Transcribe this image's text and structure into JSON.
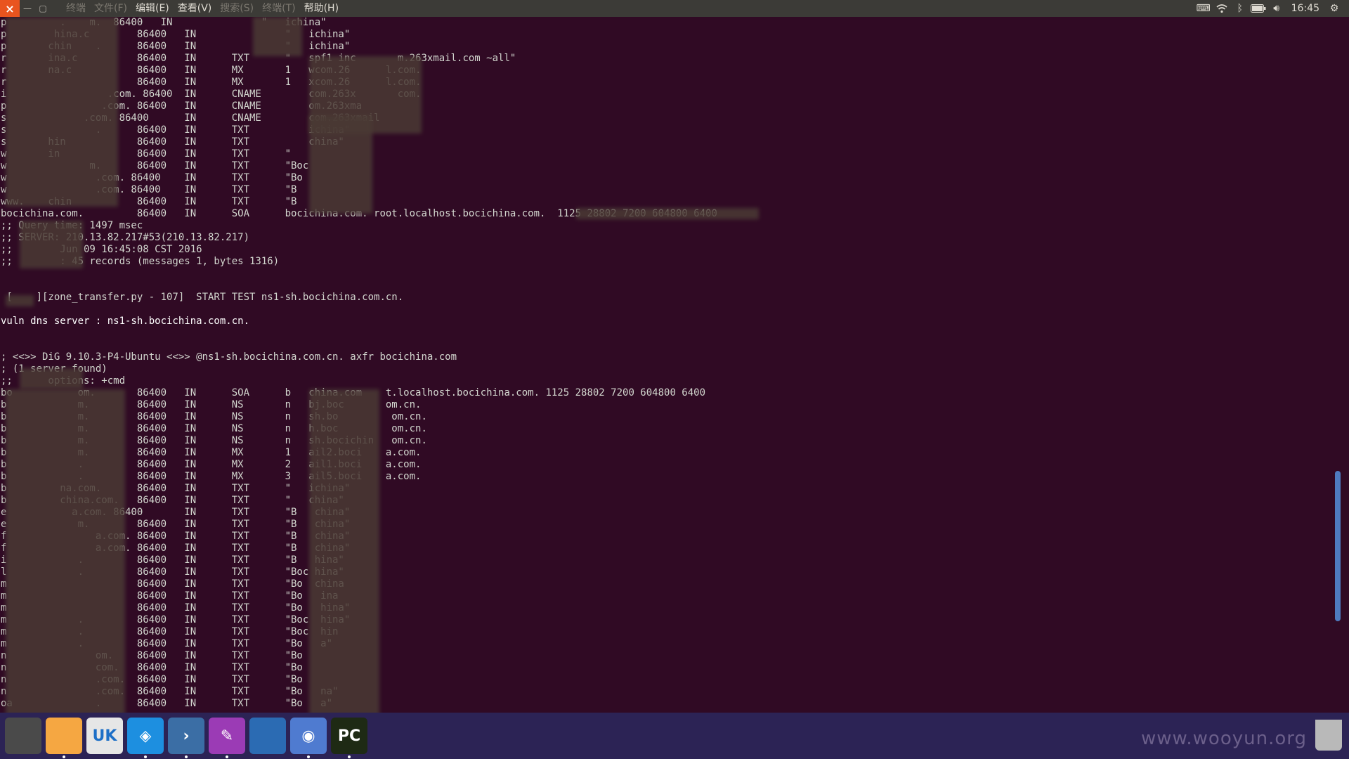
{
  "window": {
    "menus": [
      {
        "label": "终端",
        "dim": true
      },
      {
        "label": "文件(F)",
        "dim": true
      },
      {
        "label": "编辑(E)",
        "dim": false
      },
      {
        "label": "查看(V)",
        "dim": false
      },
      {
        "label": "搜索(S)",
        "dim": true
      },
      {
        "label": "终端(T)",
        "dim": true
      },
      {
        "label": "帮助(H)",
        "dim": false
      }
    ]
  },
  "tray": {
    "icons": [
      "keyboard-icon",
      "wifi-icon",
      "bluetooth-icon",
      "battery-icon",
      "volume-icon"
    ],
    "clock": "16:45",
    "settings_icon": "gear-icon"
  },
  "terminal": {
    "lines": [
      {
        "text": "p         .    m.  86400   IN               \"   ichina\"",
        "style": "normal"
      },
      {
        "text": "p        hina.c        86400   IN               \"   ichina\"",
        "style": "normal"
      },
      {
        "text": "p       chin    .      86400   IN               \"   ichina\"",
        "style": "normal"
      },
      {
        "text": "r       ina.c          86400   IN      TXT      \"   spf1 inc       m.263xmail.com ~all\"",
        "style": "normal"
      },
      {
        "text": "r       na.c           86400   IN      MX       1   wcom.26      l.com.",
        "style": "normal"
      },
      {
        "text": "r                      86400   IN      MX       1   xcom.26      l.com.",
        "style": "normal"
      },
      {
        "text": "i                 .com. 86400  IN      CNAME        com.263x       com.",
        "style": "normal"
      },
      {
        "text": "p                .com. 86400   IN      CNAME        om.263xma",
        "style": "normal"
      },
      {
        "text": "s             .com. 86400      IN      CNAME        com.263xmail",
        "style": "normal"
      },
      {
        "text": "s               .      86400   IN      TXT          ichina\"",
        "style": "normal"
      },
      {
        "text": "s       hin            86400   IN      TXT          china\"",
        "style": "normal"
      },
      {
        "text": "w       in             86400   IN      TXT      \"",
        "style": "normal"
      },
      {
        "text": "w              m.      86400   IN      TXT      \"Boc",
        "style": "normal"
      },
      {
        "text": "w               .com. 86400    IN      TXT      \"Bo",
        "style": "normal"
      },
      {
        "text": "w               .com. 86400    IN      TXT      \"B",
        "style": "normal"
      },
      {
        "text": "www.    chin           86400   IN      TXT      \"B",
        "style": "normal"
      },
      {
        "text": "bocichina.com.         86400   IN      SOA      bocichina.com. root.localhost.bocichina.com.  1125 28802 7200 604800 6400",
        "style": "normal"
      },
      {
        "text": ";; Query time: 1497 msec",
        "style": "normal"
      },
      {
        "text": ";; SERVER: 210.13.82.217#53(210.13.82.217)",
        "style": "normal"
      },
      {
        "text": ";;        Jun 09 16:45:08 CST 2016",
        "style": "normal"
      },
      {
        "text": ";;        : 45 records (messages 1, bytes 1316)",
        "style": "normal"
      },
      {
        "text": "",
        "style": "normal"
      },
      {
        "text": "",
        "style": "normal"
      },
      {
        "text": " [    ][zone_transfer.py - 107]  START TEST ns1-sh.bocichina.com.cn.",
        "style": "normal"
      },
      {
        "text": "",
        "style": "normal"
      },
      {
        "text": "vuln dns server : ns1-sh.bocichina.com.cn.",
        "style": "bright"
      },
      {
        "text": "",
        "style": "normal"
      },
      {
        "text": "",
        "style": "normal"
      },
      {
        "text": "; <<>> DiG 9.10.3-P4-Ubuntu <<>> @ns1-sh.bocichina.com.cn. axfr bocichina.com",
        "style": "normal"
      },
      {
        "text": "; (1 server found)",
        "style": "normal"
      },
      {
        "text": ";;      options: +cmd",
        "style": "normal"
      },
      {
        "text": "bo           om.       86400   IN      SOA      b   china.com    t.localhost.bocichina.com. 1125 28802 7200 604800 6400",
        "style": "normal"
      },
      {
        "text": "b            m.        86400   IN      NS       n   bj.boc       om.cn.",
        "style": "normal"
      },
      {
        "text": "b            m.        86400   IN      NS       n   sh.bo         om.cn.",
        "style": "normal"
      },
      {
        "text": "b            m.        86400   IN      NS       n   h.boc         om.cn.",
        "style": "normal"
      },
      {
        "text": "b            m.        86400   IN      NS       n   sh.bocichin   om.cn.",
        "style": "normal"
      },
      {
        "text": "b            m.        86400   IN      MX       1   ail2.boci    a.com.",
        "style": "normal"
      },
      {
        "text": "b            .         86400   IN      MX       2   ail1.boci    a.com.",
        "style": "normal"
      },
      {
        "text": "b            .         86400   IN      MX       3   ail5.boci    a.com.",
        "style": "normal"
      },
      {
        "text": "b         na.com.      86400   IN      TXT      \"   ichina\"",
        "style": "normal"
      },
      {
        "text": "b         china.com.   86400   IN      TXT      \"   china\"",
        "style": "normal"
      },
      {
        "text": "e           a.com. 86400       IN      TXT      \"B   china\"",
        "style": "normal"
      },
      {
        "text": "e            m.        86400   IN      TXT      \"B   china\"",
        "style": "normal"
      },
      {
        "text": "f               a.com. 86400   IN      TXT      \"B   china\"",
        "style": "normal"
      },
      {
        "text": "f               a.com. 86400   IN      TXT      \"B   china\"",
        "style": "normal"
      },
      {
        "text": "i            .         86400   IN      TXT      \"B   hina\"",
        "style": "normal"
      },
      {
        "text": "l            .         86400   IN      TXT      \"Boc hina\"",
        "style": "normal"
      },
      {
        "text": "m                      86400   IN      TXT      \"Bo  china",
        "style": "normal"
      },
      {
        "text": "m                      86400   IN      TXT      \"Bo   ina",
        "style": "normal"
      },
      {
        "text": "m                      86400   IN      TXT      \"Bo   hina\"",
        "style": "normal"
      },
      {
        "text": "m            .         86400   IN      TXT      \"Boc  hina\"",
        "style": "normal"
      },
      {
        "text": "m            .         86400   IN      TXT      \"Boc  hin",
        "style": "normal"
      },
      {
        "text": "m            .         86400   IN      TXT      \"Bo   a\"",
        "style": "normal"
      },
      {
        "text": "n               om.    86400   IN      TXT      \"Bo",
        "style": "normal"
      },
      {
        "text": "n               com.   86400   IN      TXT      \"Bo",
        "style": "normal"
      },
      {
        "text": "n               .com.  86400   IN      TXT      \"Bo",
        "style": "normal"
      },
      {
        "text": "n               .com.  86400   IN      TXT      \"Bo   na\"",
        "style": "normal"
      },
      {
        "text": "oa              .      86400   IN      TXT      \"Bo   a\"",
        "style": "normal"
      }
    ]
  },
  "dock": {
    "apps": [
      {
        "name": "ubuntu-launcher-icon",
        "label": "",
        "color": "#4a4a4a",
        "pip": false
      },
      {
        "name": "files-icon",
        "label": "",
        "color": "#f5a742",
        "pip": true
      },
      {
        "name": "software-center-icon",
        "label": "UK",
        "color": "#e6e6e6",
        "pip": false
      },
      {
        "name": "code-editor-icon",
        "label": "◈",
        "color": "#1d8fe0",
        "pip": true
      },
      {
        "name": "terminal-icon",
        "label": "›",
        "color": "#3b6ea5",
        "pip": true
      },
      {
        "name": "text-editor-icon",
        "label": "✎",
        "color": "#9b3bb5",
        "pip": true
      },
      {
        "name": "workspace-switcher-icon",
        "label": "",
        "color": "#2b6bb3",
        "pip": false
      },
      {
        "name": "chromium-icon",
        "label": "◉",
        "color": "#4f7bd0",
        "pip": true
      },
      {
        "name": "pycharm-icon",
        "label": "PC",
        "color": "#1e2a14",
        "pip": true
      }
    ],
    "watermark": "www.wooyun.org",
    "trash_icon": "trash-icon"
  }
}
